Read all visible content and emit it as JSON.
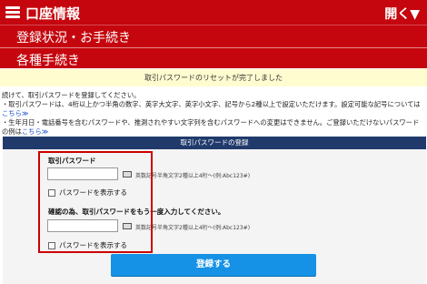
{
  "header": {
    "title": "口座情報",
    "toggle_label": "開く▼",
    "breadcrumb_1": "登録状況・お手続き",
    "breadcrumb_2": "各種手続き"
  },
  "notice": {
    "text": "取引パスワードのリセットが完了しました"
  },
  "instructions": {
    "line1": "続けて、取引パスワードを登録してください。",
    "line2": "・取引パスワードは、4桁以上かつ半角の数字、英字大文字、英字小文字、記号から2種以上で設定いただけます。設定可能な記号については",
    "link1": "こちら≫",
    "line3": "・生年月日・電話番号を含むパスワードや、推測されやすい文字列を含むパスワードへの変更はできません。ご登録いただけないパスワードの例は",
    "link2": "こちら≫"
  },
  "form": {
    "section_title": "取引パスワードの登録",
    "password_label": "取引パスワード",
    "password_value": "",
    "hint": "英数記号半角文字2種以上4桁〜(例:Abc123#)",
    "show_password_label": "パスワードを表示する",
    "confirm_label": "確認の為、取引パスワードをもう一度入力してください。",
    "confirm_value": "",
    "confirm_hint": "英数記号半角文字2種以上4桁〜(例:Abc123#)",
    "confirm_show_password_label": "パスワードを表示する",
    "submit_label": "登録する"
  },
  "colors": {
    "header_red": "#c5060e",
    "section_navy": "#203a6c",
    "submit_blue": "#1592e6",
    "highlight_red": "#cc0000",
    "notice_yellow": "#fffcd0"
  }
}
